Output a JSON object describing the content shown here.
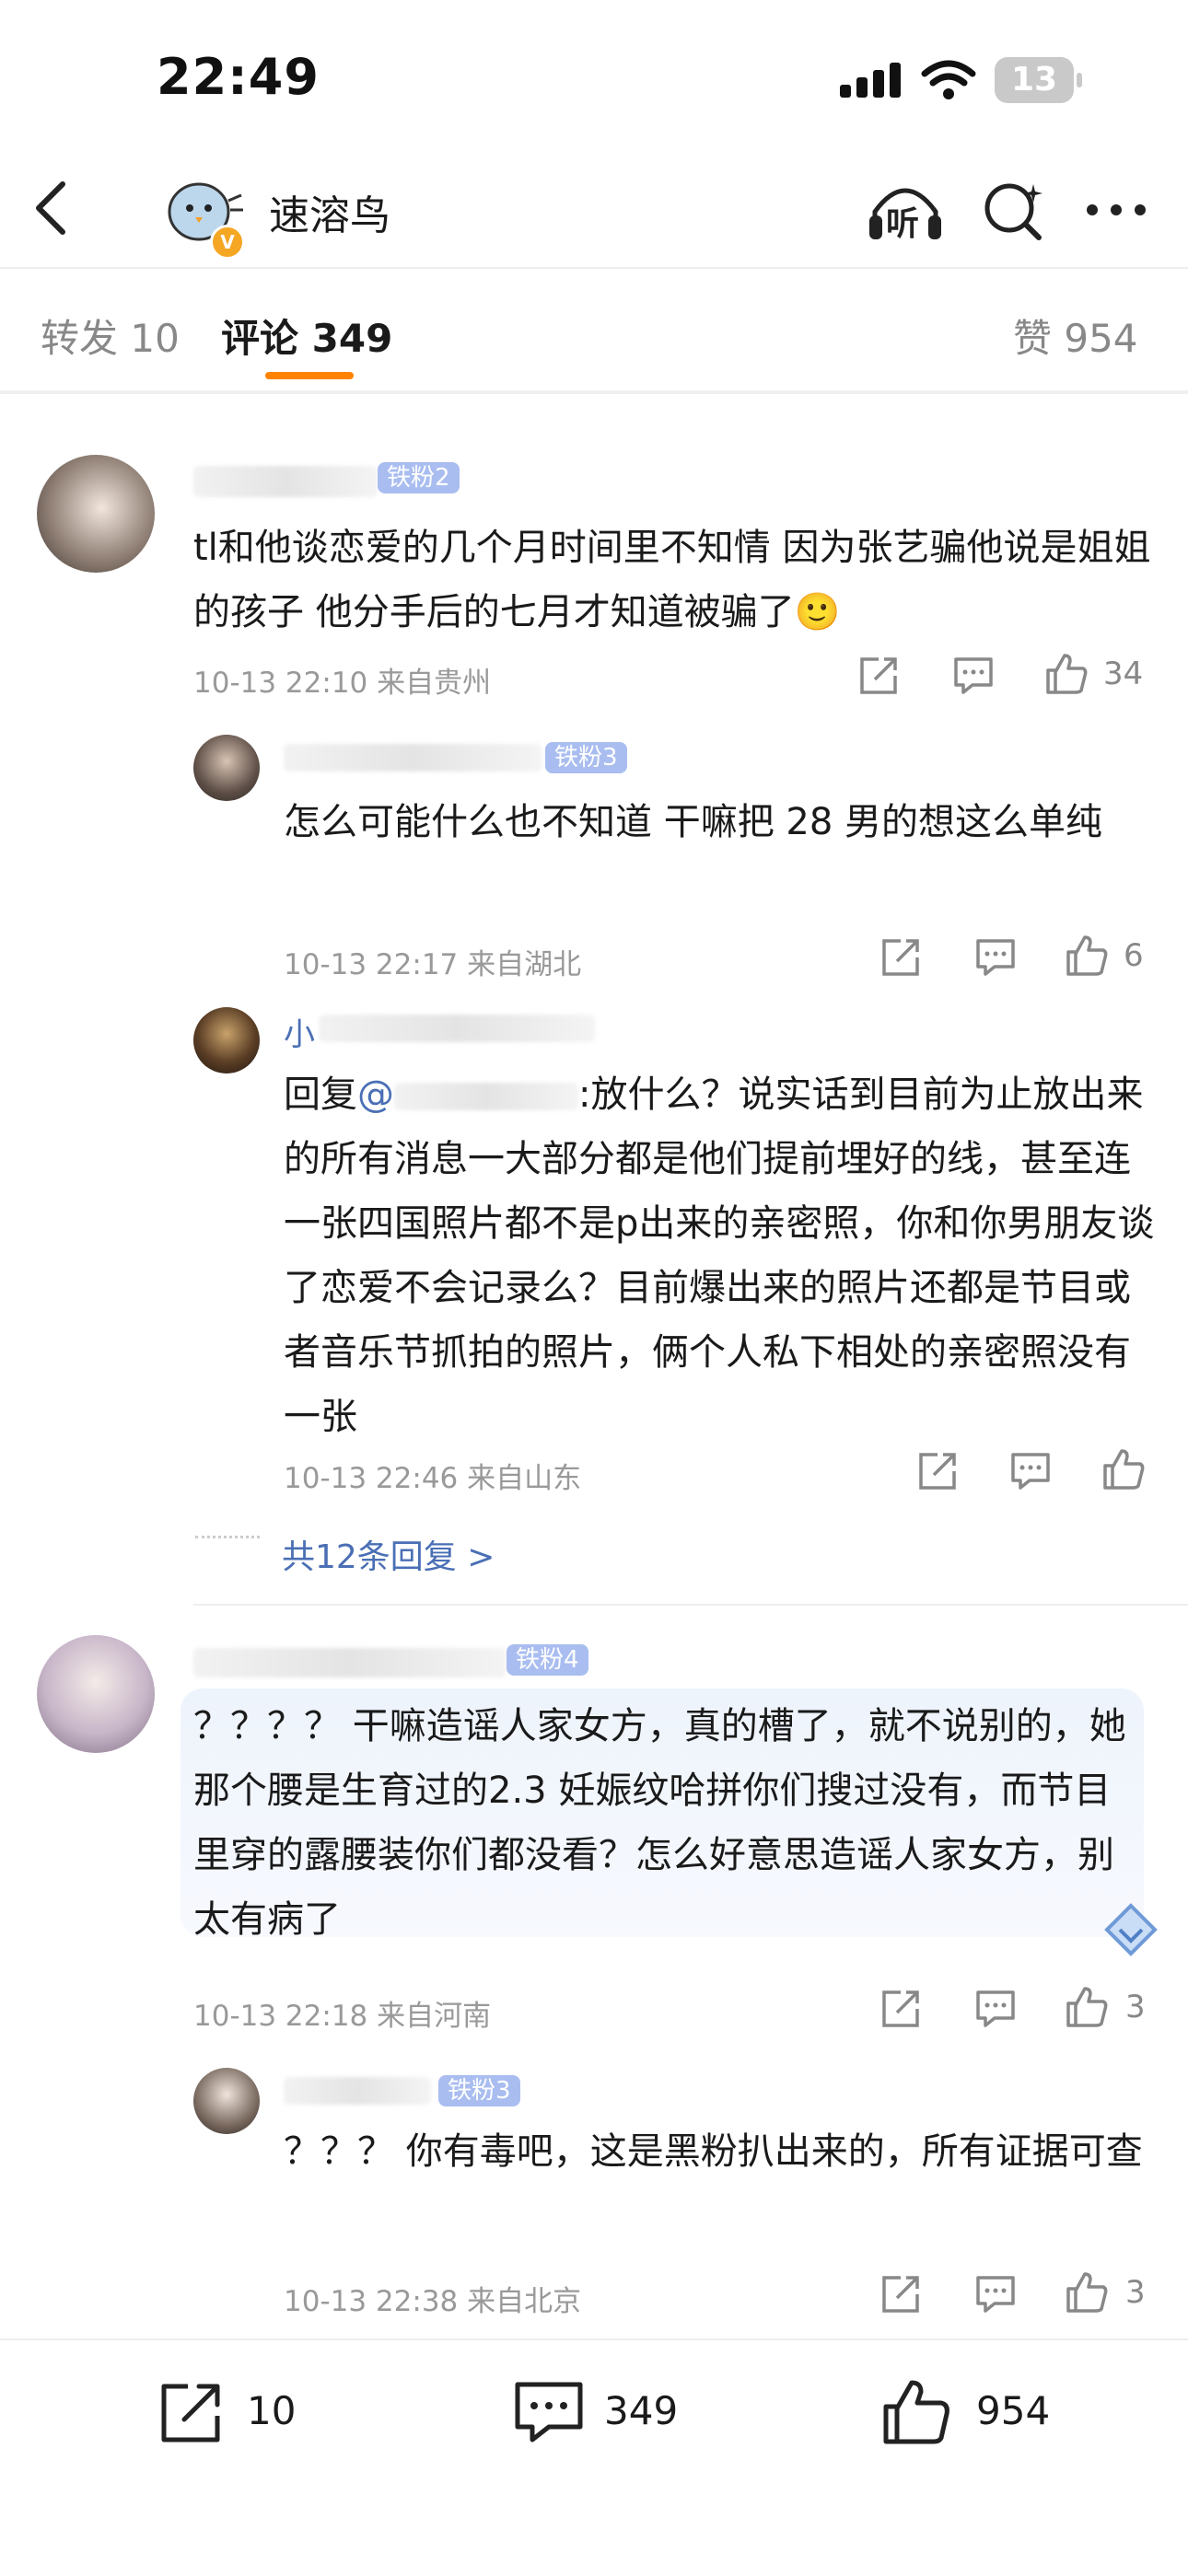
{
  "status_bar": {
    "time": "22:49",
    "battery": "13"
  },
  "header": {
    "account_name": "速溶鸟",
    "listen_label": "听"
  },
  "tabs": {
    "repost": "转发 10",
    "comments": "评论 349",
    "likes": "赞 954"
  },
  "comments": [
    {
      "badge": "铁粉2",
      "text": "tl和他谈恋爱的几个月时间里不知情 因为张艺骗他说是姐姐的孩子 他分手后的七月才知道被骗了🙂",
      "time": "10-13 22:10 来自贵州",
      "likes": "34"
    },
    {
      "badge": "铁粉3",
      "text": "怎么可能什么也不知道 干嘛把 28 男的想这么单纯",
      "time": "10-13 22:17 来自湖北",
      "likes": "6"
    },
    {
      "name": "小",
      "reply_prefix": "回复",
      "mention": "@",
      "text": ":放什么？说实话到目前为止放出来的所有消息一大部分都是他们提前埋好的线，甚至连一张四国照片都不是p出来的亲密照，你和你男朋友谈了恋爱不会记录么？目前爆出来的照片还都是节目或者音乐节抓拍的照片，俩个人私下相处的亲密照没有一张",
      "time": "10-13 22:46 来自山东",
      "likes": ""
    }
  ],
  "more_replies": "共12条回复 >",
  "comment2": {
    "badge": "铁粉4",
    "text": "？？？？ 干嘛造谣人家女方，真的槽了，就不说别的，她那个腰是生育过的2.3 妊娠纹哈拼你们搜过没有，而节目里穿的露腰装你们都没看？怎么好意思造谣人家女方，别太有病了",
    "time": "10-13 22:18 来自河南",
    "likes": "3"
  },
  "reply2": {
    "badge": "铁粉3",
    "text": "？？？ 你有毒吧，这是黑粉扒出来的，所有证据可查",
    "time": "10-13 22:38 来自北京",
    "likes": "3"
  },
  "bottom_bar": {
    "reposts": "10",
    "comments": "349",
    "likes": "954"
  }
}
